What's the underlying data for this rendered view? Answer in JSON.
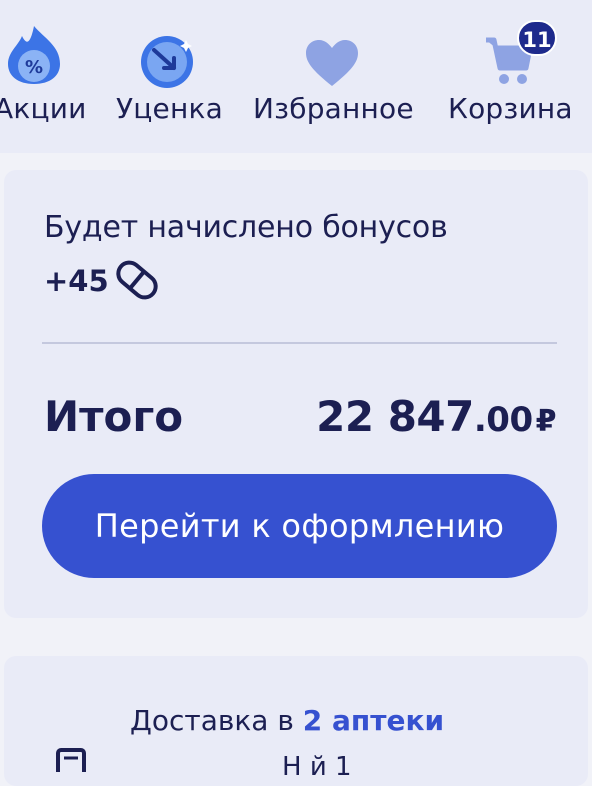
{
  "nav": {
    "items": [
      {
        "label": "Акции",
        "icon": "fire-discount-icon"
      },
      {
        "label": "Уценка",
        "icon": "markdown-arrow-icon"
      },
      {
        "label": "Избранное",
        "icon": "heart-icon"
      },
      {
        "label": "Корзина",
        "icon": "cart-icon"
      }
    ],
    "cart_count": "11"
  },
  "summary": {
    "bonus_title": "Будет начислено бонусов",
    "bonus_value": "+45",
    "total_label": "Итого",
    "total_int": "22 847",
    "total_cents": ".00",
    "currency": "₽",
    "checkout_label": "Перейти к оформлению"
  },
  "delivery": {
    "prefix": "Доставка в ",
    "link": "2 аптеки",
    "partial": "Н й     1"
  },
  "colors": {
    "accent": "#3651d0",
    "dark": "#1c1f52",
    "panel": "#e9ebf7"
  }
}
